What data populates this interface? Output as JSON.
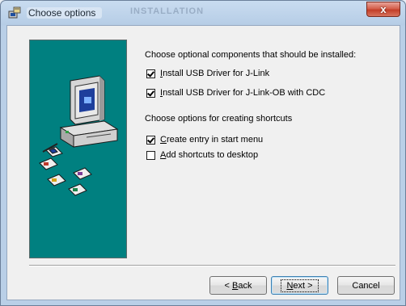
{
  "window": {
    "title": "Choose options",
    "background_title": "INSTALLATION",
    "close_glyph": "x"
  },
  "content": {
    "components_heading": "Choose optional components that should be installed:",
    "components": [
      {
        "label": "Install USB Driver for J-Link",
        "mnemonic": "I",
        "rest": "nstall USB Driver for J-Link",
        "checked": true
      },
      {
        "label": "Install USB Driver for J-Link-OB with CDC",
        "mnemonic": "I",
        "rest": "nstall USB Driver for J-Link-OB with CDC",
        "checked": true
      }
    ],
    "shortcuts_heading": "Choose options for creating shortcuts",
    "shortcuts": [
      {
        "label": "Create entry in start menu",
        "mnemonic": "C",
        "rest": "reate entry in start menu",
        "checked": true
      },
      {
        "label": "Add shortcuts to desktop",
        "mnemonic": "A",
        "rest": "dd shortcuts to desktop",
        "checked": false
      }
    ]
  },
  "buttons": {
    "back": {
      "prefix": "< ",
      "mnemonic": "B",
      "rest": "ack"
    },
    "next": {
      "mnemonic": "N",
      "rest": "ext >"
    },
    "cancel": "Cancel"
  },
  "colors": {
    "banner": "#008080",
    "close": "#c33e28"
  },
  "icons": {
    "app": "installer-icon",
    "banner": "computer-with-disks-illustration"
  }
}
